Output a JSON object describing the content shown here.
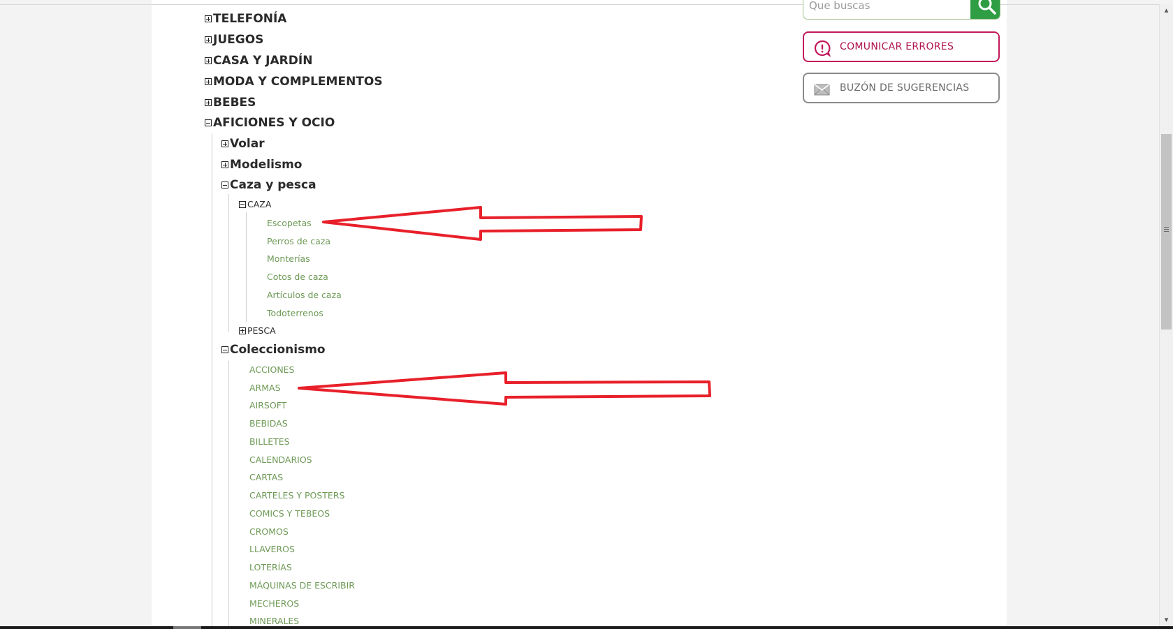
{
  "search": {
    "placeholder": "Que buscas"
  },
  "sidebar": {
    "report_errors_label": "COMUNICAR ERRORES",
    "suggestions_label": "BUZÓN DE SUGERENCIAS"
  },
  "tree": {
    "top": [
      {
        "label": "TELEFONÍA",
        "expanded": false
      },
      {
        "label": "JUEGOS",
        "expanded": false
      },
      {
        "label": "CASA Y JARDÍN",
        "expanded": false
      },
      {
        "label": "MODA Y COMPLEMENTOS",
        "expanded": false
      },
      {
        "label": "BEBES",
        "expanded": false
      },
      {
        "label": "AFICIONES Y OCIO",
        "expanded": true
      }
    ],
    "aficiones": [
      {
        "label": "Volar",
        "expanded": false
      },
      {
        "label": "Modelismo",
        "expanded": false
      },
      {
        "label": "Caza y pesca",
        "expanded": true
      },
      {
        "label": "Coleccionismo",
        "expanded": true
      }
    ],
    "caza_y_pesca": [
      {
        "label": "CAZA",
        "expanded": true
      },
      {
        "label": "PESCA",
        "expanded": false
      }
    ],
    "caza_items": [
      "Escopetas",
      "Perros de caza",
      "Monterías",
      "Cotos de caza",
      "Artículos de caza",
      "Todoterrenos"
    ],
    "coleccionismo_items": [
      "ACCIONES",
      "ARMAS",
      "AIRSOFT",
      "BEBIDAS",
      "BILLETES",
      "CALENDARIOS",
      "CARTAS",
      "CARTELES Y POSTERS",
      "COMICS Y TEBEOS",
      "CROMOS",
      "LLAVEROS",
      "LOTERÍAS",
      "MÁQUINAS DE ESCRIBIR",
      "MECHEROS",
      "MINERALES"
    ]
  },
  "colors": {
    "accent_green": "#2e9d44",
    "link_green": "#6e9a57",
    "error_magenta": "#c2185b",
    "arrow_red": "#e8202a"
  }
}
